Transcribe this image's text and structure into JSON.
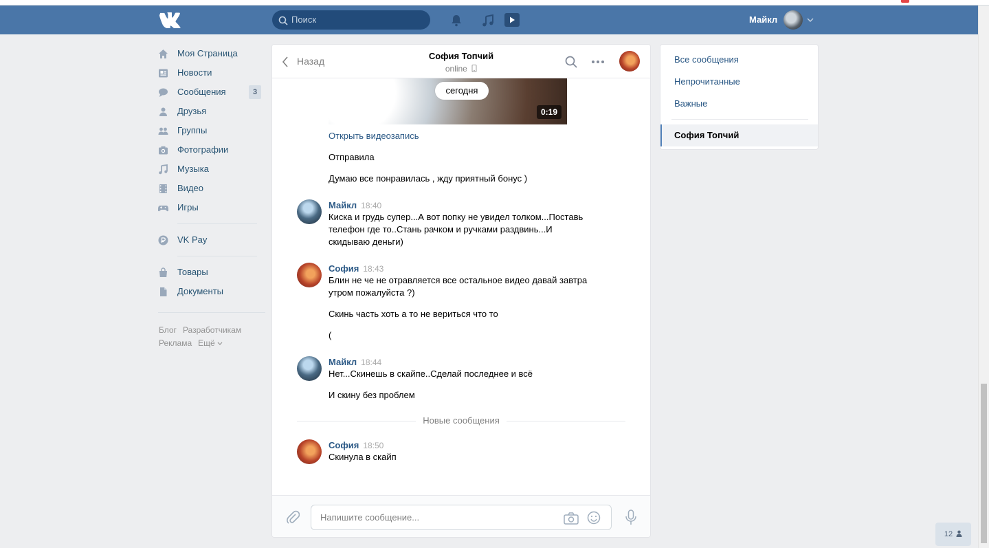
{
  "header": {
    "search_placeholder": "Поиск",
    "user_name": "Майкл"
  },
  "leftnav": {
    "items": [
      {
        "label": "Моя Страница",
        "icon": "home-icon"
      },
      {
        "label": "Новости",
        "icon": "news-icon"
      },
      {
        "label": "Сообщения",
        "icon": "messages-icon",
        "badge": "3"
      },
      {
        "label": "Друзья",
        "icon": "friend-icon"
      },
      {
        "label": "Группы",
        "icon": "groups-icon"
      },
      {
        "label": "Фотографии",
        "icon": "camera-icon"
      },
      {
        "label": "Музыка",
        "icon": "music-icon"
      },
      {
        "label": "Видео",
        "icon": "video-icon"
      },
      {
        "label": "Игры",
        "icon": "gamepad-icon"
      }
    ],
    "vkpay": "VK Pay",
    "goods": "Товары",
    "docs": "Документы",
    "footer": {
      "blog": "Блог",
      "dev": "Разработчикам",
      "ads": "Реклама",
      "more": "Ещё"
    }
  },
  "chat": {
    "back": "Назад",
    "title": "София Топчий",
    "status": "online",
    "video_duration": "0:19",
    "date_pill": "сегодня",
    "open_video": "Открыть видеозапись",
    "messages": [
      {
        "text": "Отправила"
      },
      {
        "text": "Думаю все понравилась , жду приятный бонус )"
      },
      {
        "author": "Майкл",
        "time": "18:40",
        "lines": [
          "Киска и грудь супер...А вот попку не увидел толком...Поставь",
          "телефон где то..Стань рачком и ручками раздвинь...И",
          "скидываю деньги)"
        ]
      },
      {
        "author": "София",
        "time": "18:43",
        "lines": [
          "Блин не че не отравляется все остальное видео давай завтра",
          "утром пожалуйста ?)"
        ],
        "extra": [
          "Скинь часть хоть а то не вериться что то",
          "("
        ]
      },
      {
        "author": "Майкл",
        "time": "18:44",
        "lines": [
          "Нет...Скинешь в скайпе..Сделай последнее и всё"
        ],
        "extra": [
          "И скину без проблем"
        ]
      },
      {
        "author": "София",
        "time": "18:50",
        "lines": [
          "Скинула в скайп"
        ]
      }
    ],
    "new_messages": "Новые сообщения",
    "input_placeholder": "Напишите сообщение..."
  },
  "filters": {
    "all": "Все сообщения",
    "unread": "Непрочитанные",
    "important": "Важные",
    "active": "София Топчий"
  },
  "online_counter": "12",
  "colors": {
    "header": "#4a76a8",
    "link": "#2a5885",
    "background": "#edeef0"
  }
}
